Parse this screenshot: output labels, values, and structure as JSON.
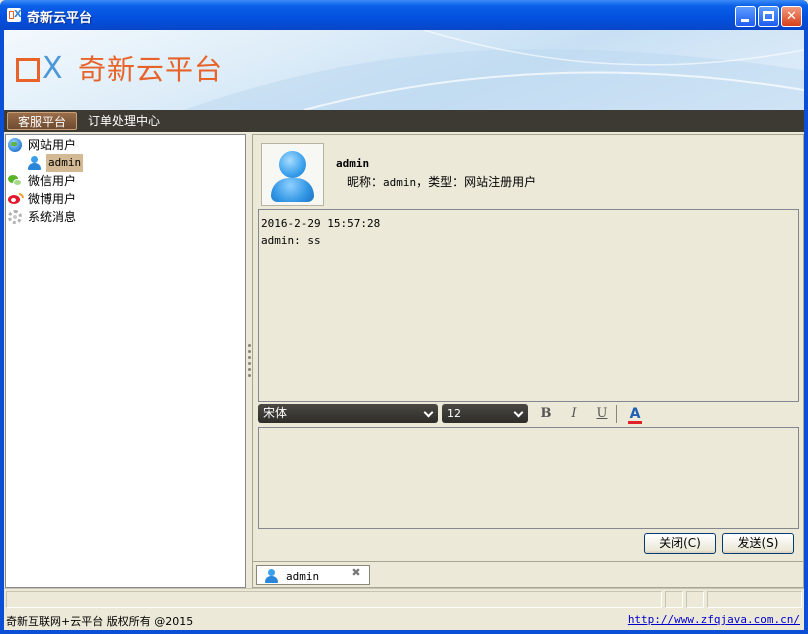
{
  "window": {
    "title": "奇新云平台"
  },
  "banner": {
    "logo_x": "X",
    "logo_text": "奇新云平台"
  },
  "menu": {
    "items": [
      "客服平台",
      "订单处理中心"
    ]
  },
  "tree": {
    "groups": [
      {
        "label": "网站用户",
        "icon": "globe-icon"
      },
      {
        "label": "微信用户",
        "icon": "wechat-icon"
      },
      {
        "label": "微博用户",
        "icon": "weibo-icon"
      },
      {
        "label": "系统消息",
        "icon": "gear-icon"
      }
    ],
    "child": {
      "label": "admin",
      "icon": "user-icon"
    }
  },
  "profile": {
    "name": "admin",
    "nickname_label": "昵称：",
    "nickname": "admin",
    "type_label": "，类型：",
    "type": "网站注册用户"
  },
  "chat": {
    "messages": [
      {
        "time": "2016-2-29 15:57:28",
        "text": "admin: ss"
      }
    ]
  },
  "toolbar": {
    "font": "宋体",
    "size": "12",
    "bold": "B",
    "italic": "I",
    "underline": "U",
    "font_color": "A"
  },
  "buttons": {
    "close": "关闭(C)",
    "send": "发送(S)"
  },
  "tabs": [
    {
      "label": "admin"
    }
  ],
  "footer": {
    "copyright": "奇新互联网+云平台 版权所有 @2015",
    "link": "http://www.zfqjava.com.cn/"
  },
  "colors": {
    "brand_orange": "#e8632a",
    "brand_blue": "#4a97d9",
    "titlebar_blue": "#0350df",
    "menubar": "#3d3a34"
  }
}
